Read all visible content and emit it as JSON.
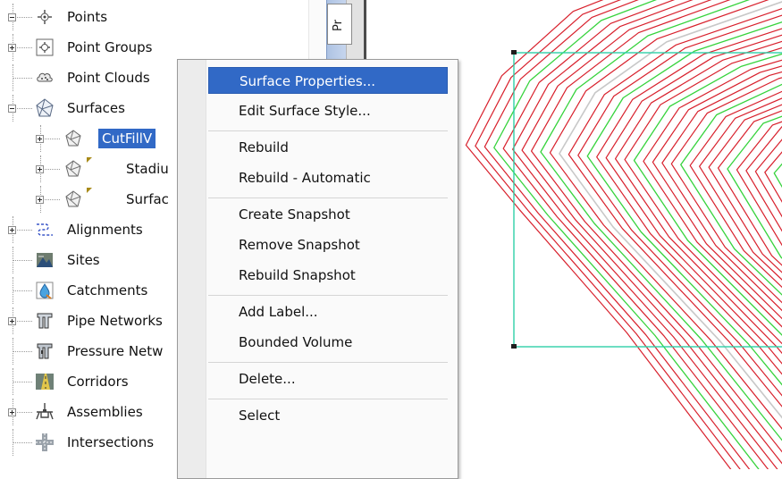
{
  "tree": {
    "items": [
      {
        "label": "Points",
        "icon": "points-icon",
        "expander": "minus",
        "selected": false
      },
      {
        "label": "Point Groups",
        "icon": "point-groups-icon",
        "expander": "plus",
        "selected": false
      },
      {
        "label": "Point Clouds",
        "icon": "point-clouds-icon",
        "expander": "none",
        "selected": false
      },
      {
        "label": "Surfaces",
        "icon": "surfaces-icon",
        "expander": "minus",
        "selected": false
      },
      {
        "label": "CutFillV",
        "icon": "surface-icon",
        "expander": "plus",
        "selected": true
      },
      {
        "label": "Stadiu",
        "icon": "surface-icon",
        "expander": "plus",
        "selected": false,
        "flag": true
      },
      {
        "label": "Surfac",
        "icon": "surface-icon",
        "expander": "plus",
        "selected": false,
        "flag": true
      },
      {
        "label": "Alignments",
        "icon": "alignments-icon",
        "expander": "plus",
        "selected": false
      },
      {
        "label": "Sites",
        "icon": "sites-icon",
        "expander": "none",
        "selected": false
      },
      {
        "label": "Catchments",
        "icon": "catchments-icon",
        "expander": "none",
        "selected": false
      },
      {
        "label": "Pipe Networks",
        "icon": "pipe-networks-icon",
        "expander": "plus",
        "selected": false
      },
      {
        "label": "Pressure Netw",
        "icon": "pressure-networks-icon",
        "expander": "none",
        "selected": false
      },
      {
        "label": "Corridors",
        "icon": "corridors-icon",
        "expander": "none",
        "selected": false
      },
      {
        "label": "Assemblies",
        "icon": "assemblies-icon",
        "expander": "plus",
        "selected": false
      },
      {
        "label": "Intersections",
        "icon": "intersections-icon",
        "expander": "none",
        "selected": false
      }
    ]
  },
  "strip": {
    "tab_label": "Pr"
  },
  "context_menu": {
    "items": [
      {
        "label": "Surface Properties...",
        "highlighted": true
      },
      {
        "label": "Edit Surface Style...",
        "highlighted": false
      },
      {
        "separator": true
      },
      {
        "label": "Rebuild",
        "highlighted": false
      },
      {
        "label": "Rebuild - Automatic",
        "highlighted": false
      },
      {
        "separator": true
      },
      {
        "label": "Create Snapshot",
        "highlighted": false
      },
      {
        "label": "Remove Snapshot",
        "highlighted": false
      },
      {
        "label": "Rebuild Snapshot",
        "highlighted": false
      },
      {
        "separator": true
      },
      {
        "label": "Add Label...",
        "highlighted": false
      },
      {
        "label": "Bounded Volume",
        "highlighted": false
      },
      {
        "separator": true
      },
      {
        "label": "Delete...",
        "highlighted": false
      },
      {
        "separator": true
      },
      {
        "label": "Select",
        "highlighted": false
      }
    ]
  },
  "drawing": {
    "colors": {
      "contour_minor": "#d8202c",
      "contour_major": "#36d33c",
      "contour_highlight": "#c8c8c8",
      "boundary": "#2fd0a8"
    }
  }
}
